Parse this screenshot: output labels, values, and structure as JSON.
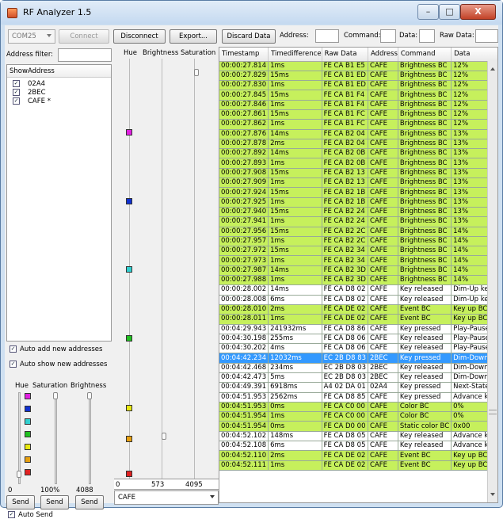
{
  "window": {
    "title": "RF Analyzer 1.5",
    "min": "–",
    "max": "□",
    "close": "X"
  },
  "toolbar": {
    "port": "COM25",
    "connect": "Connect",
    "disconnect": "Disconnect",
    "export": "Export...",
    "discard": "Discard Data",
    "address_label": "Address:",
    "command_label": "Command:",
    "data_label": "Data:",
    "raw_label": "Raw Data:"
  },
  "left": {
    "filter_label": "Address filter:",
    "col_show": "Show",
    "col_address": "Address",
    "addresses": [
      {
        "name": "02A4",
        "checked": true
      },
      {
        "name": "2BEC",
        "checked": true
      },
      {
        "name": "CAFE *",
        "checked": true
      }
    ],
    "auto_add": "Auto add new addresses",
    "auto_show": "Auto show new addresses",
    "hue": "Hue",
    "saturation": "Saturation",
    "brightness": "Brightness",
    "hue_value": "0",
    "sat_value": "100%",
    "bright_value": "4088",
    "send": "Send",
    "auto_send": "Auto Send",
    "swatches": [
      "#e020e0",
      "#1030d0",
      "#30d0d0",
      "#20c020",
      "#e8e810",
      "#e8a010",
      "#e02020"
    ]
  },
  "mid": {
    "hue": "Hue",
    "brightness": "Brightness",
    "saturation": "Saturation",
    "min": "0",
    "mid": "573",
    "max": "4095",
    "address": "CAFE",
    "marks": [
      "#e020e0",
      "#1030d0",
      "#30d0d0",
      "#20c020",
      "#e8e810",
      "#e8a010",
      "#e02020"
    ]
  },
  "table": {
    "headers": [
      "Timestamp",
      "Timedifference",
      "Raw Data",
      "Address",
      "Command",
      "Data"
    ],
    "rows": [
      [
        "00:00:27.814",
        "1ms",
        "FE CA B1 E5",
        "CAFE",
        "Brightness BC",
        "12%",
        "g"
      ],
      [
        "00:00:27.829",
        "15ms",
        "FE CA B1 ED",
        "CAFE",
        "Brightness BC",
        "12%",
        "g"
      ],
      [
        "00:00:27.830",
        "1ms",
        "FE CA B1 ED",
        "CAFE",
        "Brightness BC",
        "12%",
        "g"
      ],
      [
        "00:00:27.845",
        "15ms",
        "FE CA B1 F4",
        "CAFE",
        "Brightness BC",
        "12%",
        "g"
      ],
      [
        "00:00:27.846",
        "1ms",
        "FE CA B1 F4",
        "CAFE",
        "Brightness BC",
        "12%",
        "g"
      ],
      [
        "00:00:27.861",
        "15ms",
        "FE CA B1 FC",
        "CAFE",
        "Brightness BC",
        "12%",
        "g"
      ],
      [
        "00:00:27.862",
        "1ms",
        "FE CA B1 FC",
        "CAFE",
        "Brightness BC",
        "12%",
        "g"
      ],
      [
        "00:00:27.876",
        "14ms",
        "FE CA B2 04",
        "CAFE",
        "Brightness BC",
        "13%",
        "g"
      ],
      [
        "00:00:27.878",
        "2ms",
        "FE CA B2 04",
        "CAFE",
        "Brightness BC",
        "13%",
        "g"
      ],
      [
        "00:00:27.892",
        "14ms",
        "FE CA B2 0B",
        "CAFE",
        "Brightness BC",
        "13%",
        "g"
      ],
      [
        "00:00:27.893",
        "1ms",
        "FE CA B2 0B",
        "CAFE",
        "Brightness BC",
        "13%",
        "g"
      ],
      [
        "00:00:27.908",
        "15ms",
        "FE CA B2 13",
        "CAFE",
        "Brightness BC",
        "13%",
        "g"
      ],
      [
        "00:00:27.909",
        "1ms",
        "FE CA B2 13",
        "CAFE",
        "Brightness BC",
        "13%",
        "g"
      ],
      [
        "00:00:27.924",
        "15ms",
        "FE CA B2 1B",
        "CAFE",
        "Brightness BC",
        "13%",
        "g"
      ],
      [
        "00:00:27.925",
        "1ms",
        "FE CA B2 1B",
        "CAFE",
        "Brightness BC",
        "13%",
        "g"
      ],
      [
        "00:00:27.940",
        "15ms",
        "FE CA B2 24",
        "CAFE",
        "Brightness BC",
        "13%",
        "g"
      ],
      [
        "00:00:27.941",
        "1ms",
        "FE CA B2 24",
        "CAFE",
        "Brightness BC",
        "13%",
        "g"
      ],
      [
        "00:00:27.956",
        "15ms",
        "FE CA B2 2C",
        "CAFE",
        "Brightness BC",
        "14%",
        "g"
      ],
      [
        "00:00:27.957",
        "1ms",
        "FE CA B2 2C",
        "CAFE",
        "Brightness BC",
        "14%",
        "g"
      ],
      [
        "00:00:27.972",
        "15ms",
        "FE CA B2 34",
        "CAFE",
        "Brightness BC",
        "14%",
        "g"
      ],
      [
        "00:00:27.973",
        "1ms",
        "FE CA B2 34",
        "CAFE",
        "Brightness BC",
        "14%",
        "g"
      ],
      [
        "00:00:27.987",
        "14ms",
        "FE CA B2 3D",
        "CAFE",
        "Brightness BC",
        "14%",
        "g"
      ],
      [
        "00:00:27.988",
        "1ms",
        "FE CA B2 3D",
        "CAFE",
        "Brightness BC",
        "14%",
        "g"
      ],
      [
        "00:00:28.002",
        "14ms",
        "FE CA D8 02",
        "CAFE",
        "Key released",
        "Dim-Up key",
        "w"
      ],
      [
        "00:00:28.008",
        "6ms",
        "FE CA D8 02",
        "CAFE",
        "Key released",
        "Dim-Up key",
        "w"
      ],
      [
        "00:00:28.010",
        "2ms",
        "FE CA DE 02",
        "CAFE",
        "Event BC",
        "Key up BC",
        "g"
      ],
      [
        "00:00:28.011",
        "1ms",
        "FE CA DE 02",
        "CAFE",
        "Event BC",
        "Key up BC",
        "g"
      ],
      [
        "00:04:29.943",
        "241932ms",
        "FE CA D8 86",
        "CAFE",
        "Key pressed",
        "Play-Pause...",
        "w"
      ],
      [
        "00:04:30.198",
        "255ms",
        "FE CA D8 06",
        "CAFE",
        "Key released",
        "Play-Pause...",
        "w"
      ],
      [
        "00:04:30.202",
        "4ms",
        "FE CA D8 06",
        "CAFE",
        "Key released",
        "Play-Pause...",
        "w"
      ],
      [
        "00:04:42.234",
        "12032ms",
        "EC 2B D8 83",
        "2BEC",
        "Key pressed",
        "Dim-Down ...",
        "s"
      ],
      [
        "00:04:42.468",
        "234ms",
        "EC 2B D8 03",
        "2BEC",
        "Key released",
        "Dim-Down ...",
        "w"
      ],
      [
        "00:04:42.473",
        "5ms",
        "EC 2B D8 03",
        "2BEC",
        "Key released",
        "Dim-Down ...",
        "w"
      ],
      [
        "00:04:49.391",
        "6918ms",
        "A4 02 DA 01",
        "02A4",
        "Key pressed",
        "Next-State...",
        "w"
      ],
      [
        "00:04:51.953",
        "2562ms",
        "FE CA D8 85",
        "CAFE",
        "Key pressed",
        "Advance key",
        "w"
      ],
      [
        "00:04:51.953",
        "0ms",
        "FE CA C0 00",
        "CAFE",
        "Color BC",
        "0%",
        "g"
      ],
      [
        "00:04:51.954",
        "1ms",
        "FE CA C0 00",
        "CAFE",
        "Color BC",
        "0%",
        "g"
      ],
      [
        "00:04:51.954",
        "0ms",
        "FE CA D0 00",
        "CAFE",
        "Static color BC",
        "0x00",
        "g"
      ],
      [
        "00:04:52.102",
        "148ms",
        "FE CA D8 05",
        "CAFE",
        "Key released",
        "Advance key",
        "w"
      ],
      [
        "00:04:52.108",
        "6ms",
        "FE CA D8 05",
        "CAFE",
        "Key released",
        "Advance key",
        "w"
      ],
      [
        "00:04:52.110",
        "2ms",
        "FE CA DE 02",
        "CAFE",
        "Event BC",
        "Key up BC",
        "g"
      ],
      [
        "00:04:52.111",
        "1ms",
        "FE CA DE 02",
        "CAFE",
        "Event BC",
        "Key up BC",
        "g"
      ]
    ]
  }
}
